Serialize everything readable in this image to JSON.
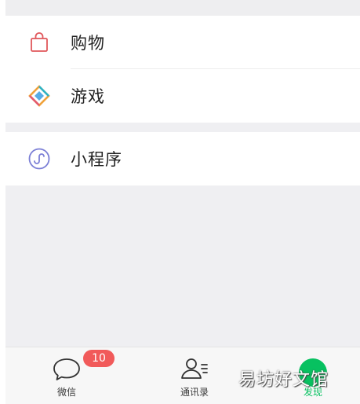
{
  "menu": {
    "items": [
      {
        "label": "购物",
        "icon": "shopping-bag-icon"
      },
      {
        "label": "游戏",
        "icon": "game-diamond-icon"
      },
      {
        "label": "小程序",
        "icon": "mini-program-icon"
      }
    ]
  },
  "tabbar": {
    "tabs": [
      {
        "label": "微信",
        "icon": "chat-bubble-icon",
        "badge": "10"
      },
      {
        "label": "通讯录",
        "icon": "contacts-icon"
      },
      {
        "label": "发现",
        "icon": "discover-icon"
      }
    ]
  },
  "watermark": "易坊好文馆",
  "colors": {
    "accent_green": "#07c160",
    "badge_red": "#f15a5a",
    "background": "#efeff2"
  }
}
